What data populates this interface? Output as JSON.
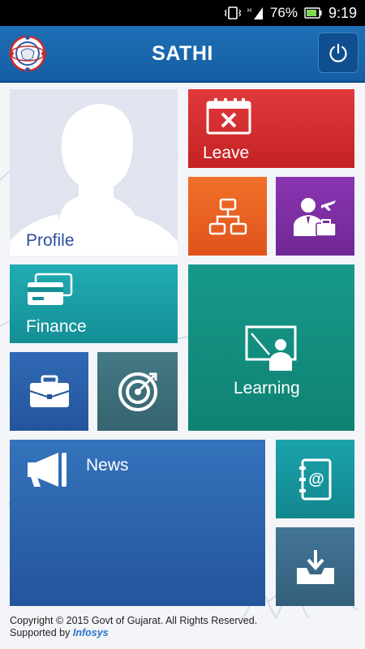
{
  "status_bar": {
    "battery": "76%",
    "time": "9:19"
  },
  "header": {
    "title": "SATHI"
  },
  "tiles": {
    "profile": "Profile",
    "leave": "Leave",
    "finance": "Finance",
    "learning": "Learning",
    "news": "News"
  },
  "colors": {
    "header": "#1a69b0",
    "leave": "#d42a2c",
    "org": "#e85a1b",
    "travel": "#7b2fa1",
    "finance": "#1aa2a8",
    "learning": "#14907f",
    "job": "#2c5fa8",
    "target": "#3c6e7b",
    "news": "#2d62ad",
    "contacts": "#16939c",
    "download": "#3a6984"
  },
  "footer": {
    "copyright": "Copyright © 2015 Govt of Gujarat. All Rights Reserved.",
    "supported_by": "Supported by",
    "sponsor": "Infosys"
  }
}
